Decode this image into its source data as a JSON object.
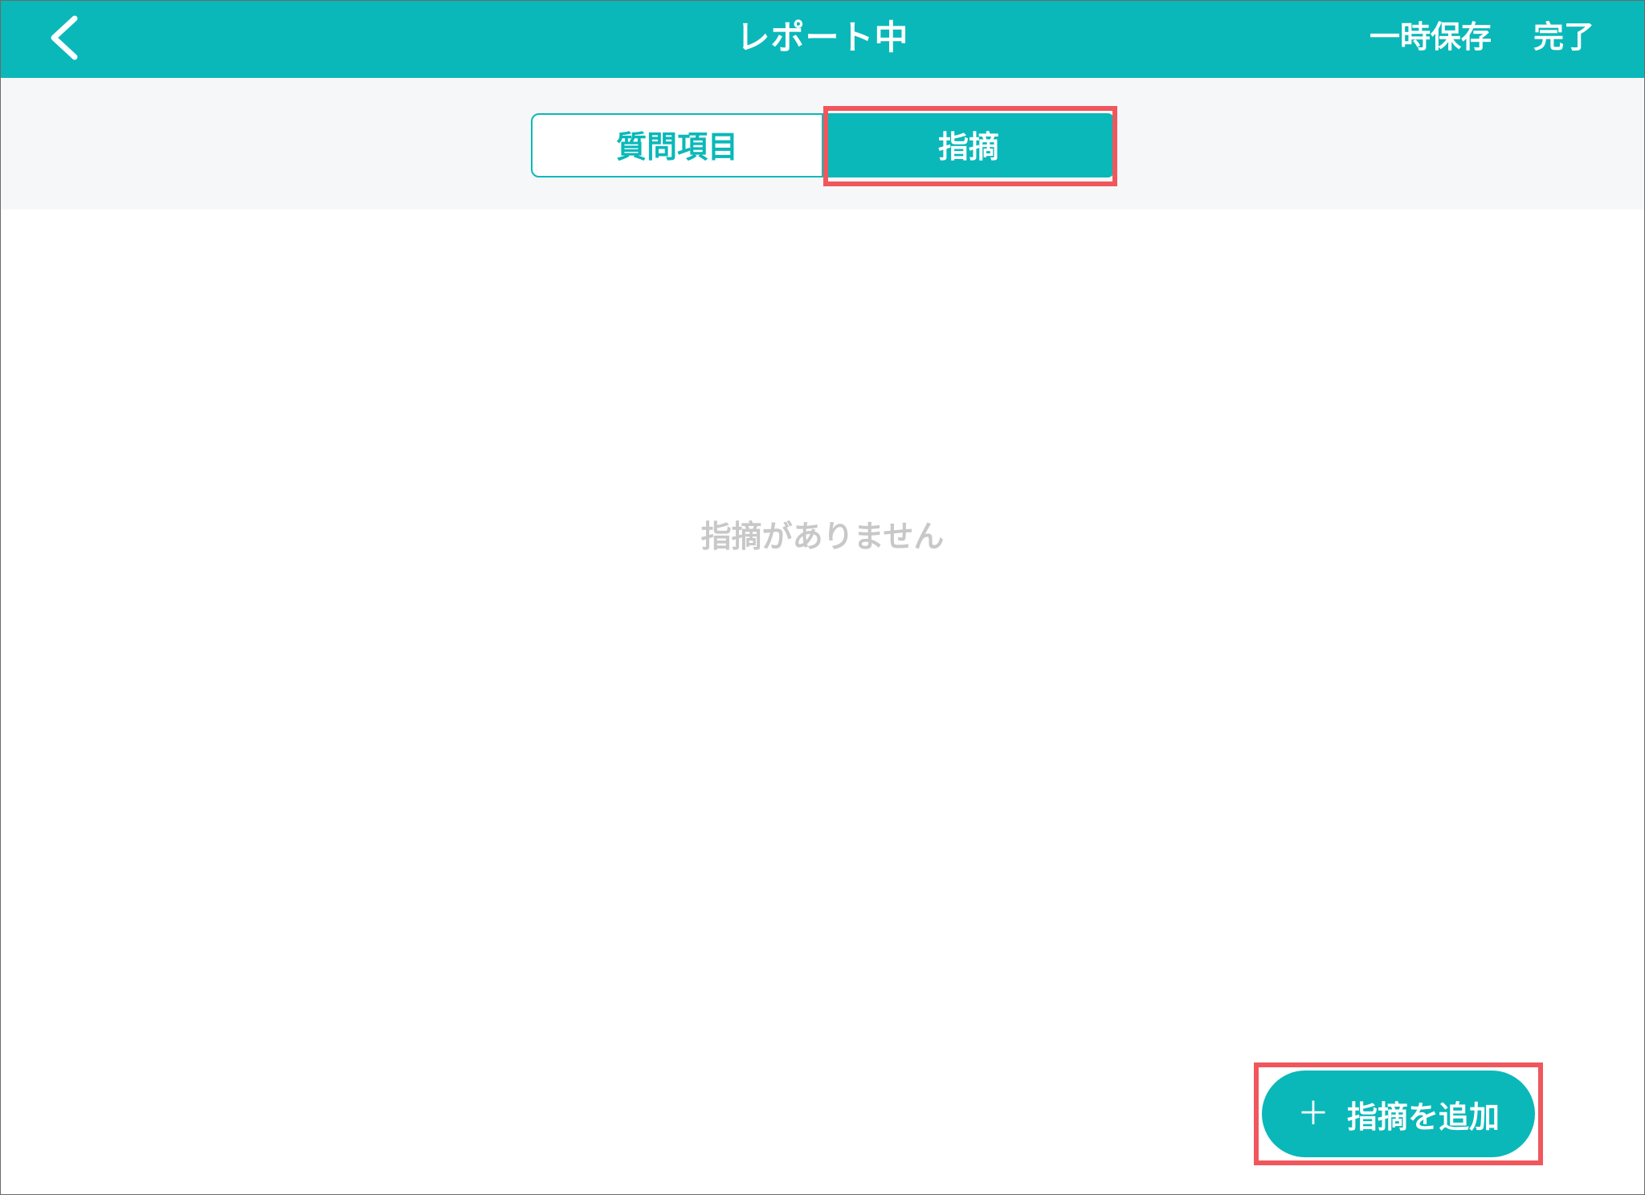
{
  "header": {
    "title": "レポート中",
    "save_label": "一時保存",
    "done_label": "完了",
    "back_icon": "chevron-left-icon"
  },
  "tabs": [
    {
      "label": "質問項目",
      "selected": false
    },
    {
      "label": "指摘",
      "selected": true
    }
  ],
  "main": {
    "empty_message": "指摘がありません"
  },
  "add_button": {
    "icon": "plus-icon",
    "icon_glyph": "＋",
    "label": "指摘を追加"
  },
  "colors": {
    "accent": "#0ab8b9",
    "highlight": "#f0575c",
    "segment_background": "#f6f7f8",
    "empty_text": "#c8c8c8"
  }
}
